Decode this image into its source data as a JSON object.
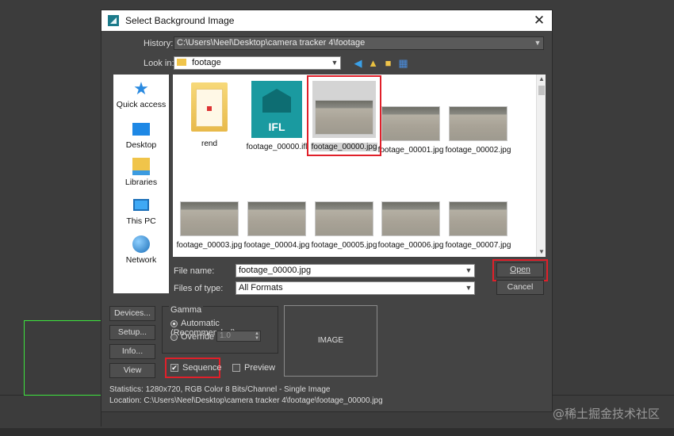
{
  "dialog": {
    "title": "Select Background Image",
    "close_glyph": "✕"
  },
  "history": {
    "label": "History:",
    "value": "C:\\Users\\Neel\\Desktop\\camera tracker 4\\footage"
  },
  "look_in": {
    "label": "Look in:",
    "value": "footage"
  },
  "places": [
    {
      "label": "Quick access"
    },
    {
      "label": "Desktop"
    },
    {
      "label": "Libraries"
    },
    {
      "label": "This PC"
    },
    {
      "label": "Network"
    }
  ],
  "files": [
    {
      "name": "rend",
      "type": "folder"
    },
    {
      "name": "footage_00000.ifl",
      "type": "ifl",
      "badge": "IFL"
    },
    {
      "name": "footage_00000.jpg",
      "type": "image",
      "selected": true
    },
    {
      "name": "footage_00001.jpg",
      "type": "image"
    },
    {
      "name": "footage_00002.jpg",
      "type": "image"
    },
    {
      "name": "footage_00003.jpg",
      "type": "image"
    },
    {
      "name": "footage_00004.jpg",
      "type": "image"
    },
    {
      "name": "footage_00005.jpg",
      "type": "image"
    },
    {
      "name": "footage_00006.jpg",
      "type": "image"
    },
    {
      "name": "footage_00007.jpg",
      "type": "image"
    }
  ],
  "file_name": {
    "label": "File name:",
    "value": "footage_00000.jpg"
  },
  "files_of_type": {
    "label": "Files of type:",
    "value": "All Formats"
  },
  "buttons": {
    "open": "Open",
    "cancel": "Cancel",
    "devices": "Devices...",
    "setup": "Setup...",
    "info": "Info...",
    "view": "View"
  },
  "gamma": {
    "title": "Gamma",
    "automatic": "Automatic (Recommended)",
    "override": "Override",
    "override_value": "1.0"
  },
  "options": {
    "sequence": "Sequence",
    "preview": "Preview",
    "sequence_checked": true,
    "preview_checked": false
  },
  "image_preview": "IMAGE",
  "statistics": "Statistics:  1280x720, RGB Color 8 Bits/Channel - Single Image",
  "location": "Location:  C:\\Users\\Neel\\Desktop\\camera tracker 4\\footage\\footage_00000.jpg",
  "watermark": "@稀土掘金技术社区",
  "colors": {
    "highlight": "#e0202a",
    "viewport_box": "#3ee63e"
  }
}
